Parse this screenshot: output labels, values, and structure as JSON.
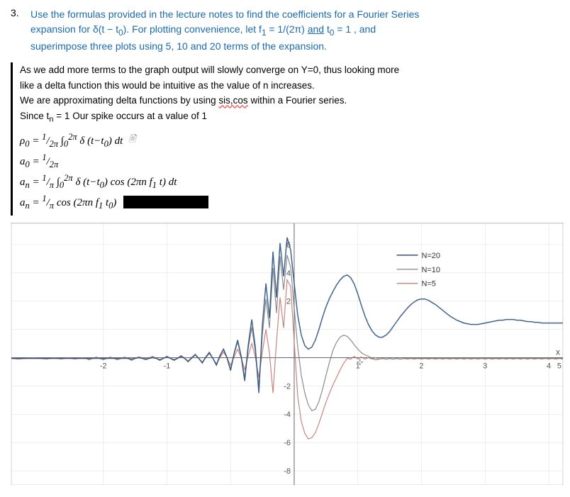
{
  "question": {
    "number": "3.",
    "text_part1": "Use the formulas provided in the lecture notes to find the coefficients for a Fourier Series expansion for δ(t − t₀). For plotting convenience, let f₁ = 1/(2π)",
    "text_underlined": "and",
    "text_part2": "t₀ = 1 , and superimpose three plots using 5, 10 and 20 terms of the expansion."
  },
  "answer": {
    "line1": "As we add more terms to the graph output will slowly converge on Y=0, thus looking more",
    "line2": "like a delta function this would be intuitive as the value of n increases.",
    "line3": "We are approximating delta functions by using sis,cos within a Fourier series.",
    "line4": "Since t₀ = 1 Our spike occurs at a value of 1",
    "formulas": [
      "ρ₀ = (1/2π) ∫₀²π δ(t−t₀) dt",
      "a₀ = 1/2π",
      "aₙ = (1/π) ∫₀²π δ(t−t₀) cos(2πn f₁ t) dt",
      "aₙ = (1/π) cos(2πn f₁ t₀)"
    ]
  },
  "graph": {
    "x_axis_label": "x",
    "y_values": [
      "-8",
      "-6",
      "-4",
      "-2",
      "2",
      "4",
      "6"
    ],
    "x_values": [
      "-2",
      "-1",
      "1",
      "2",
      "3",
      "4",
      "5"
    ],
    "legend": [
      {
        "label": "N=20",
        "color": "#2c5282"
      },
      {
        "label": "N=10",
        "color": "#555555"
      },
      {
        "label": "N=5",
        "color": "#888888"
      }
    ]
  },
  "icons": {
    "cursor": "⊹"
  }
}
